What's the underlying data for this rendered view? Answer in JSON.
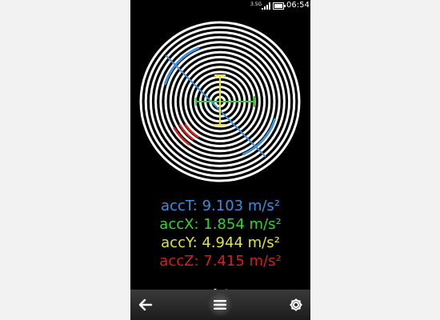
{
  "status_bar": {
    "network": "3.5G",
    "time": "06:54",
    "icons": [
      "signal-icon",
      "battery-icon"
    ]
  },
  "sensor": {
    "ring_color": "#ffffff",
    "colors": {
      "total": "#3b8fe0",
      "x": "#2ed52e",
      "y": "#e5e52a",
      "z": "#d41f1f"
    }
  },
  "readouts": [
    {
      "key": "total",
      "text": "accT: 9.103 m/s²",
      "color": "#3b8fe0",
      "value": 9.103,
      "unit": "m/s²"
    },
    {
      "key": "x",
      "text": "accX: 1.854 m/s²",
      "color": "#2ed52e",
      "value": 1.854,
      "unit": "m/s²"
    },
    {
      "key": "y",
      "text": "accY: 4.944 m/s²",
      "color": "#e5e52a",
      "value": 4.944,
      "unit": "m/s²"
    },
    {
      "key": "z",
      "text": "accZ: 7.415 m/s²",
      "color": "#d41f1f",
      "value": 7.415,
      "unit": "m/s²"
    }
  ],
  "pager": {
    "pages": 2,
    "active": 1
  },
  "toolbar": {
    "back_icon": "back-arrow-icon",
    "menu_icon": "menu-icon",
    "settings_icon": "gear-icon"
  }
}
